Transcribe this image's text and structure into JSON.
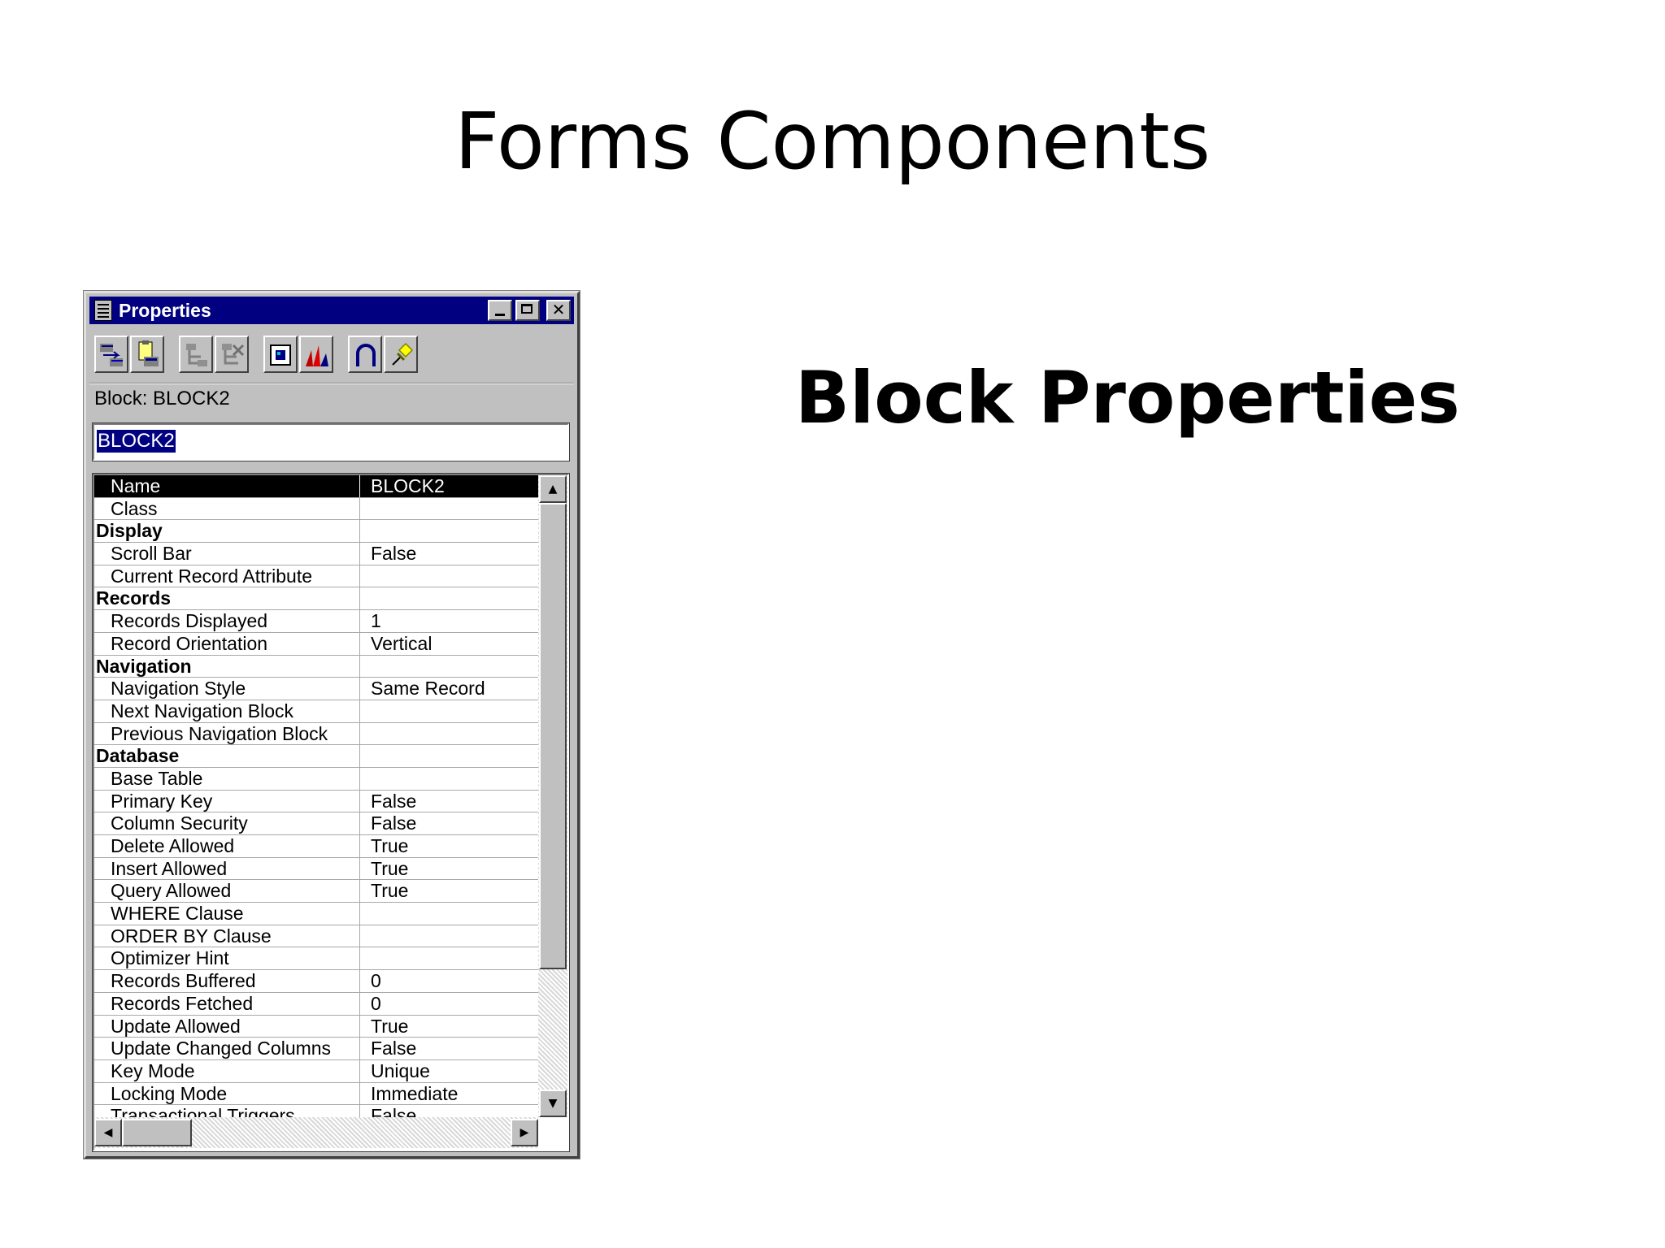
{
  "slide": {
    "title": "Forms Components",
    "side_heading": "Block Properties"
  },
  "window": {
    "title": "Properties",
    "context_label": "Block: BLOCK2",
    "name_value": "BLOCK2"
  },
  "toolbar": {
    "tools": [
      "copy-properties-icon",
      "paste-properties-icon",
      "add-property-icon",
      "delete-property-icon",
      "property-class-icon",
      "inherit-icon",
      "intersection-union-icon",
      "freeze-pin-icon"
    ]
  },
  "properties": [
    {
      "type": "prop",
      "name": "Name",
      "value": "BLOCK2",
      "selected": true
    },
    {
      "type": "prop",
      "name": "Class",
      "value": ""
    },
    {
      "type": "cat",
      "name": "Display"
    },
    {
      "type": "prop",
      "name": "Scroll Bar",
      "value": "False"
    },
    {
      "type": "prop",
      "name": "Current Record Attribute",
      "value": ""
    },
    {
      "type": "cat",
      "name": "Records"
    },
    {
      "type": "prop",
      "name": "Records Displayed",
      "value": "1"
    },
    {
      "type": "prop",
      "name": "Record Orientation",
      "value": "Vertical"
    },
    {
      "type": "cat",
      "name": "Navigation"
    },
    {
      "type": "prop",
      "name": "Navigation Style",
      "value": "Same Record"
    },
    {
      "type": "prop",
      "name": "Next Navigation Block",
      "value": ""
    },
    {
      "type": "prop",
      "name": "Previous Navigation Block",
      "value": ""
    },
    {
      "type": "cat",
      "name": "Database"
    },
    {
      "type": "prop",
      "name": "Base Table",
      "value": ""
    },
    {
      "type": "prop",
      "name": "Primary Key",
      "value": "False"
    },
    {
      "type": "prop",
      "name": "Column Security",
      "value": "False"
    },
    {
      "type": "prop",
      "name": "Delete Allowed",
      "value": "True"
    },
    {
      "type": "prop",
      "name": "Insert Allowed",
      "value": "True"
    },
    {
      "type": "prop",
      "name": "Query Allowed",
      "value": "True"
    },
    {
      "type": "prop",
      "name": "WHERE Clause",
      "value": ""
    },
    {
      "type": "prop",
      "name": "ORDER BY Clause",
      "value": ""
    },
    {
      "type": "prop",
      "name": "Optimizer Hint",
      "value": ""
    },
    {
      "type": "prop",
      "name": "Records Buffered",
      "value": "0"
    },
    {
      "type": "prop",
      "name": "Records Fetched",
      "value": "0"
    },
    {
      "type": "prop",
      "name": "Update Allowed",
      "value": "True"
    },
    {
      "type": "prop",
      "name": "Update Changed Columns",
      "value": "False"
    },
    {
      "type": "prop",
      "name": "Key Mode",
      "value": "Unique"
    },
    {
      "type": "prop",
      "name": "Locking Mode",
      "value": "Immediate"
    },
    {
      "type": "prop",
      "name": "Transactional Triggers",
      "value": "False"
    }
  ],
  "colors": {
    "titlebar": "#000080",
    "window_face": "#c0c0c0",
    "selected_row": "#000000"
  }
}
